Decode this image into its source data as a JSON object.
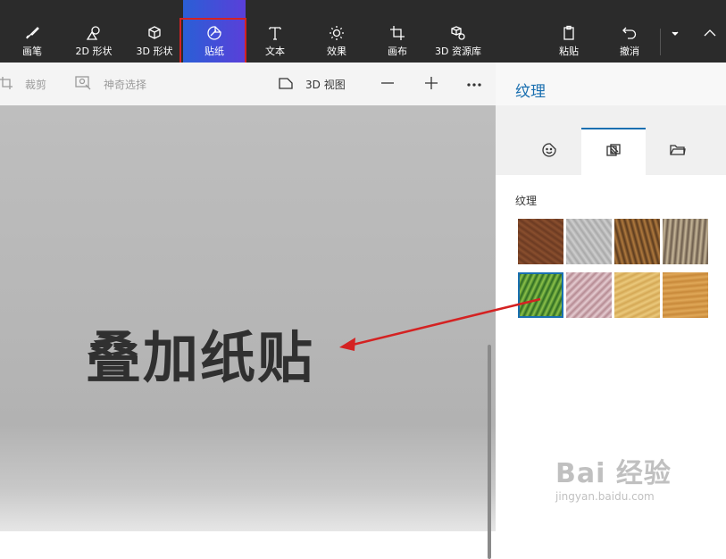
{
  "toolbar": {
    "tools": [
      {
        "label": "画笔",
        "icon": "brush-icon"
      },
      {
        "label": "2D 形状",
        "icon": "shapes-2d-icon"
      },
      {
        "label": "3D 形状",
        "icon": "cube-icon"
      },
      {
        "label": "贴纸",
        "icon": "sticker-icon",
        "active": true
      },
      {
        "label": "文本",
        "icon": "text-icon"
      },
      {
        "label": "效果",
        "icon": "effects-sun-icon"
      },
      {
        "label": "画布",
        "icon": "canvas-crop-icon"
      },
      {
        "label": "3D 资源库",
        "icon": "library-3d-icon"
      }
    ],
    "paste_label": "粘贴",
    "undo_label": "撤消"
  },
  "subbar": {
    "crop_label": "裁剪",
    "magic_select_label": "神奇选择",
    "view3d_label": "3D 视图"
  },
  "canvas": {
    "text": "叠加纸贴"
  },
  "panel": {
    "title": "纹理",
    "section_label": "纹理",
    "tabs": [
      "sticker-face-icon",
      "texture-icon",
      "folder-icon"
    ],
    "textures": [
      {
        "name": "wood-bark",
        "colors": [
          "#6b3a22",
          "#8a4f2e"
        ]
      },
      {
        "name": "granite-gray",
        "colors": [
          "#a8a8a8",
          "#cfcfcf"
        ]
      },
      {
        "name": "hair-brown",
        "colors": [
          "#5a3a1e",
          "#b07a3e"
        ]
      },
      {
        "name": "pebbles",
        "colors": [
          "#6a5a4a",
          "#c8b89a"
        ]
      },
      {
        "name": "leaves-green",
        "colors": [
          "#2d6b22",
          "#8dc34a"
        ],
        "selected": true
      },
      {
        "name": "marble-pink",
        "colors": [
          "#b58a92",
          "#e6cdd2"
        ]
      },
      {
        "name": "sand",
        "colors": [
          "#d4a855",
          "#ebc97c"
        ]
      },
      {
        "name": "wood-light",
        "colors": [
          "#c8893a",
          "#e0a858"
        ]
      }
    ]
  },
  "watermark": {
    "brand": "Bai 经验",
    "url": "jingyan.baidu.com"
  },
  "colors": {
    "toolbar_bg": "#2b2b2b",
    "accent": "#1a6fb0",
    "highlight_box": "#d42222",
    "arrow": "#d42222"
  }
}
